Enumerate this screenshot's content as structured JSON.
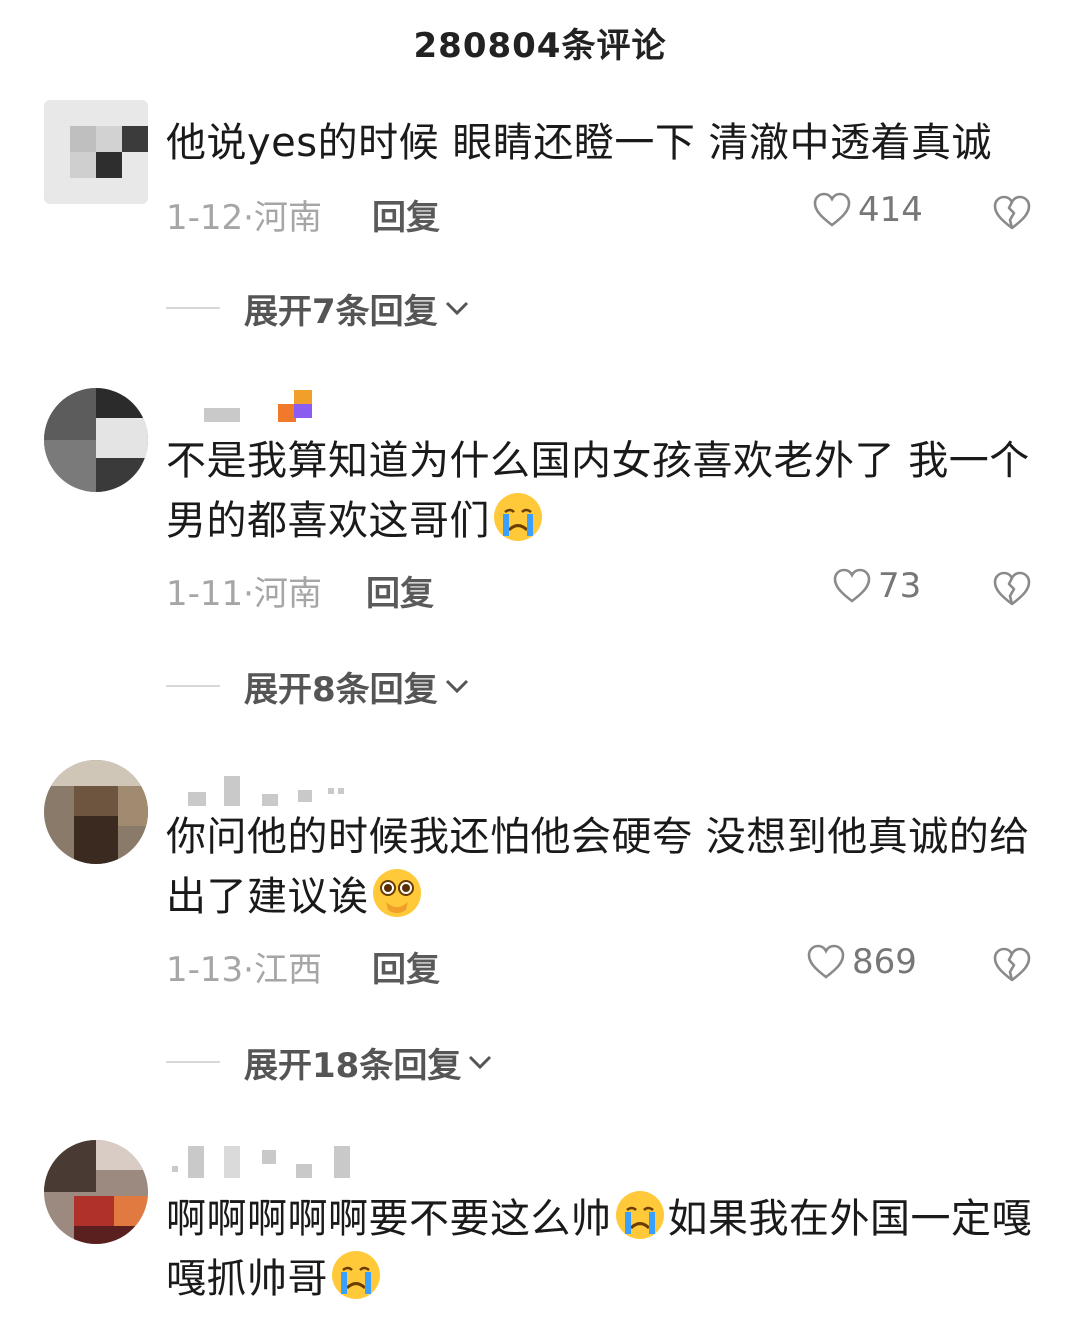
{
  "header": {
    "title": "280804条评论"
  },
  "comments": [
    {
      "text_parts": [
        "他说yes的时候 眼睛还瞪一下 清澈中透着真诚"
      ],
      "date": "1-12·河南",
      "reply_label": "回复",
      "likes": "414",
      "expand_label": "展开7条回复"
    },
    {
      "text_parts": [
        "不是我算知道为什么国内女孩喜欢老外了 我一个男的都喜欢这哥们"
      ],
      "emojis": [
        "crying-face"
      ],
      "date": "1-11·河南",
      "reply_label": "回复",
      "likes": "73",
      "expand_label": "展开8条回复"
    },
    {
      "text_parts": [
        "你问他的时候我还怕他会硬夸 没想到他真诚的给出了建议诶"
      ],
      "emojis": [
        "pleading-face"
      ],
      "date": "1-13·江西",
      "reply_label": "回复",
      "likes": "869",
      "expand_label": "展开18条回复"
    },
    {
      "text_parts": [
        "啊啊啊啊啊要不要这么帅",
        "如果我在外国一定嘎嘎抓帅哥"
      ],
      "emojis": [
        "crying-face",
        "crying-face"
      ]
    }
  ],
  "colors": {
    "like_icon": "#8a8a8a",
    "meta_text": "#a6a6a6",
    "emoji_yellow": "#ffc93a",
    "tear_blue": "#3aa0ff"
  }
}
